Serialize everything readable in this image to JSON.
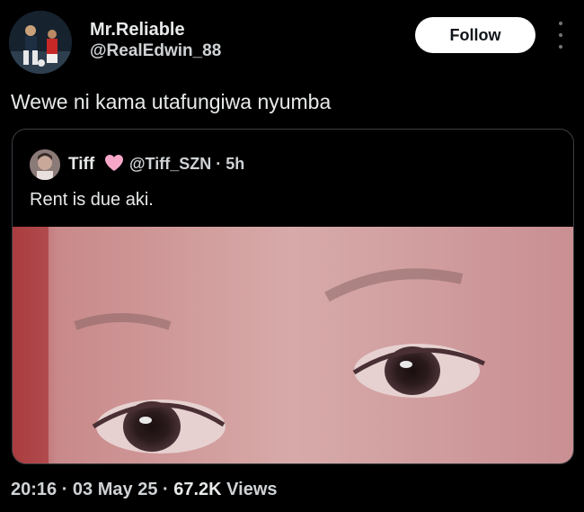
{
  "author": {
    "display_name": "Mr.Reliable",
    "handle": "@RealEdwin_88",
    "avatar_icon": "profile-photo"
  },
  "actions": {
    "follow_label": "Follow",
    "more_icon": "more-vertical-icon"
  },
  "tweet": {
    "text": "Wewe ni kama utafungiwa nyumba"
  },
  "quoted_tweet": {
    "display_name": "Tiff",
    "name_emoji_icon": "pink-heart-icon",
    "handle_time": "@Tiff_SZN · 5h",
    "text": "Rent is due aki.",
    "media_icon": "selfie-photo"
  },
  "meta": {
    "timestamp": "20:16 · 03 May 25 ·",
    "views_count": "67.2K",
    "views_label": "Views"
  },
  "colors": {
    "background": "#000000",
    "text_primary": "#e7e9ea",
    "text_secondary": "#71767b",
    "follow_button_bg": "#ffffff",
    "quote_border": "#3a3f44",
    "heart": "#f7a8c9"
  }
}
